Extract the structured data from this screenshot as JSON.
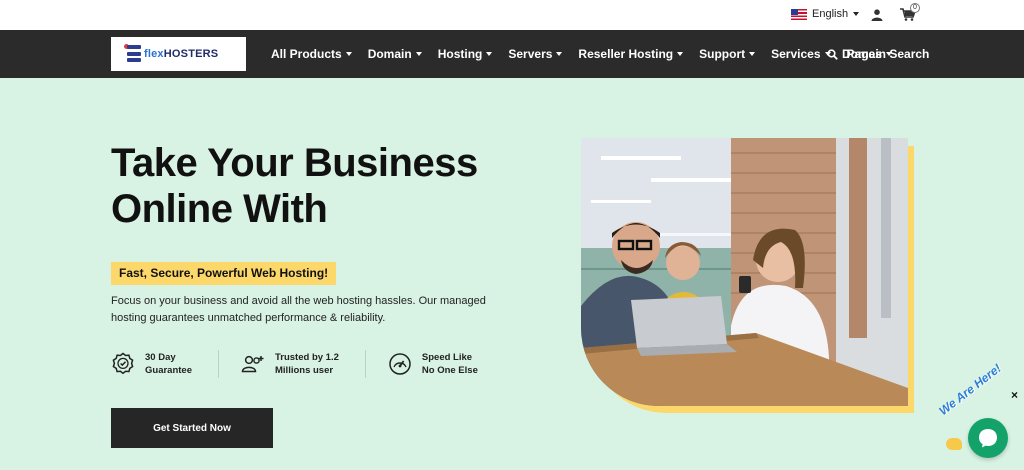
{
  "topbar": {
    "language": "English",
    "cart_count": "0"
  },
  "nav": {
    "logo_flex": "flex",
    "logo_hosters": "HOSTERS",
    "items": [
      {
        "label": "All Products"
      },
      {
        "label": "Domain"
      },
      {
        "label": "Hosting"
      },
      {
        "label": "Servers"
      },
      {
        "label": "Reseller Hosting"
      },
      {
        "label": "Support"
      },
      {
        "label": "Services"
      },
      {
        "label": "Pages"
      }
    ],
    "search_label": "Domain Search"
  },
  "hero": {
    "headline_line1": "Take Your Business",
    "headline_line2": "Online With",
    "tagline": "Fast, Secure, Powerful Web Hosting!",
    "description": "Focus on your business and avoid all the web hosting hassles. Our managed hosting guarantees unmatched performance & reliability.",
    "features": [
      {
        "line1": "30 Day",
        "line2": "Guarantee",
        "icon": "badge-check-icon"
      },
      {
        "line1": "Trusted by 1.2",
        "line2": "Millions user",
        "icon": "users-plus-icon"
      },
      {
        "line1": "Speed Like",
        "line2": "No One Else",
        "icon": "speedometer-icon"
      }
    ],
    "cta_label": "Get Started Now"
  },
  "chat": {
    "label": "We Are Here!",
    "close": "×"
  },
  "colors": {
    "hero_bg": "#d8f3e4",
    "nav_bg": "#2b2b2b",
    "accent_yellow": "#fcd86a",
    "chat_green": "#13a36a"
  }
}
